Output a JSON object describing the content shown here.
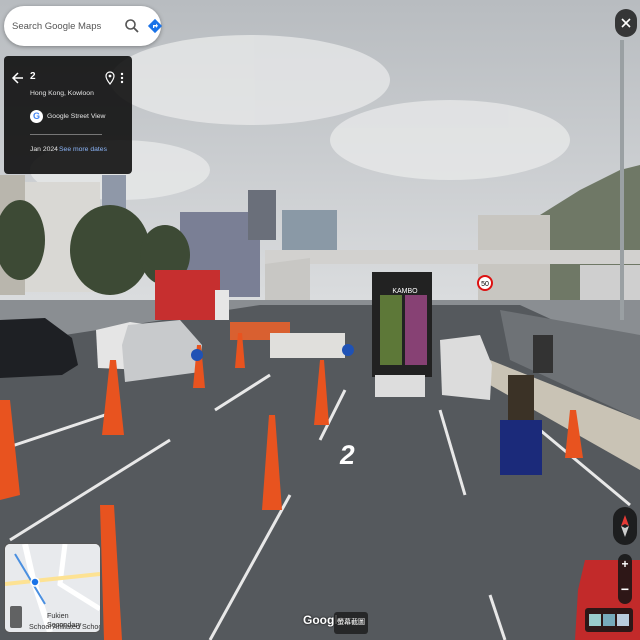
{
  "search": {
    "placeholder": "Search Google Maps"
  },
  "info_card": {
    "title": "2",
    "subtitle": "Hong Kong, Kowloon",
    "provider": "Google Street View",
    "date": "Jan 2024",
    "see_more_dates": "See more dates"
  },
  "scene": {
    "road_marking": "2",
    "truck_brand": "KAMBO",
    "speed_sign": "50"
  },
  "minimap": {
    "label_line1": "Fukien Secondary",
    "label_line2": "School Affiliated School"
  },
  "footer": {
    "brand": "Google",
    "screenshot_label": "螢幕截圖"
  },
  "colors": {
    "card_bg": "#0a0a0a",
    "link": "#8ab4f8",
    "road": "#55595d",
    "cone_orange": "#e8531f"
  },
  "icons": [
    "search-icon",
    "directions-icon",
    "back-arrow-icon",
    "pin-icon",
    "more-vert-icon",
    "close-icon",
    "compass-icon",
    "zoom-in-icon",
    "zoom-out-icon",
    "layers-icon",
    "expand-icon"
  ]
}
